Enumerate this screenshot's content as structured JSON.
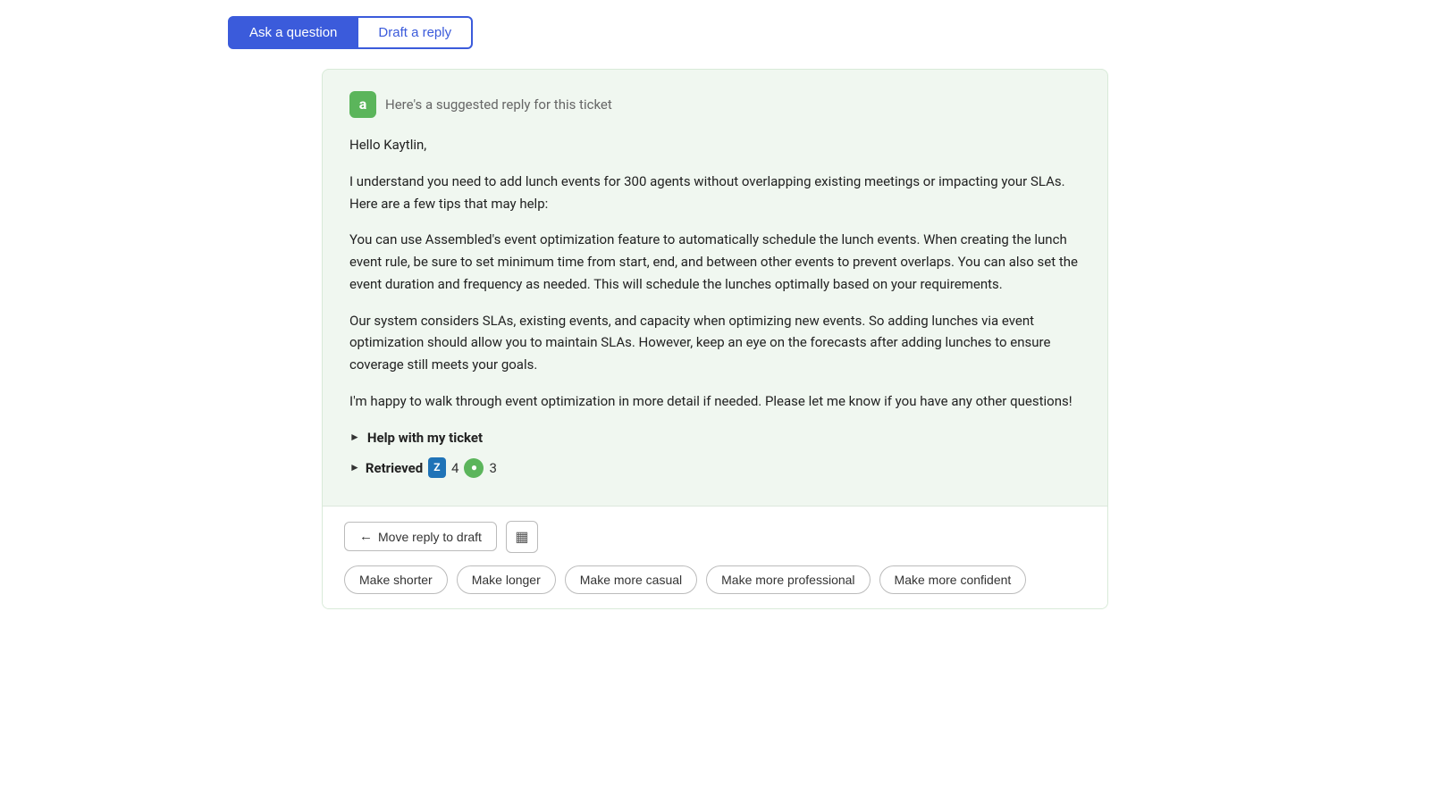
{
  "tabs": [
    {
      "id": "ask-question",
      "label": "Ask a question",
      "active": true
    },
    {
      "id": "draft-reply",
      "label": "Draft a reply",
      "active": false
    }
  ],
  "card": {
    "header_text": "Here's a suggested reply for this ticket",
    "icon_label": "a",
    "paragraphs": [
      "Hello Kaytlin,",
      "I understand you need to add lunch events for 300 agents without overlapping existing meetings or impacting your SLAs. Here are a few tips that may help:",
      "You can use Assembled's event optimization feature to automatically schedule the lunch events. When creating the lunch event rule, be sure to set minimum time from start, end, and between other events to prevent overlaps. You can also set the event duration and frequency as needed. This will schedule the lunches optimally based on your requirements.",
      "Our system considers SLAs, existing events, and capacity when optimizing new events. So adding lunches via event optimization should allow you to maintain SLAs. However, keep an eye on the forecasts after adding lunches to ensure coverage still meets your goals.",
      "I'm happy to walk through event optimization in more detail if needed. Please let me know if you have any other questions!"
    ],
    "collapsible_1": {
      "label": "Help with my ticket"
    },
    "collapsible_2": {
      "label": "Retrieved",
      "zendesk_count": "4",
      "assembled_count": "3"
    }
  },
  "footer": {
    "move_draft_label": "Move reply to draft",
    "style_buttons": [
      {
        "id": "make-shorter",
        "label": "Make shorter"
      },
      {
        "id": "make-longer",
        "label": "Make longer"
      },
      {
        "id": "make-casual",
        "label": "Make more casual"
      },
      {
        "id": "make-professional",
        "label": "Make more professional"
      },
      {
        "id": "make-confident",
        "label": "Make more confident"
      }
    ]
  }
}
